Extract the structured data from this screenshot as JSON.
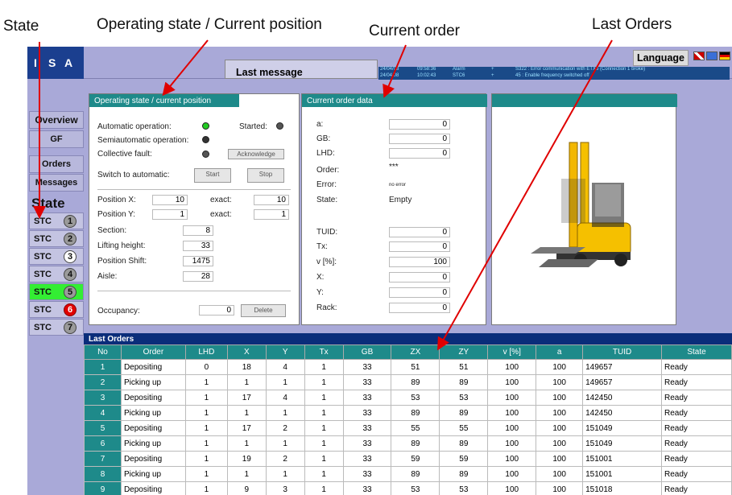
{
  "annotations": {
    "state": "State",
    "operating": "Operating state / Current position",
    "current_order": "Current order",
    "last_orders": "Last Orders"
  },
  "topbar": {
    "last_message_label": "Last message",
    "language_label": "Language",
    "messages": [
      {
        "date": "24/04/08",
        "time": "09:58:36",
        "type": "Alarm",
        "sign": "+",
        "text": "S322 : Error communication with ETX6 (Connection 1 broke)"
      },
      {
        "date": "24/04/08",
        "time": "10:02:43",
        "type": "STC6",
        "sign": "+",
        "text": "45 : Enable frequency switched off"
      }
    ]
  },
  "logo": {
    "letters": [
      "I",
      "S",
      "A"
    ]
  },
  "nav": {
    "overview": "Overview",
    "gf": "GF",
    "orders": "Orders",
    "messages": "Messages",
    "state_title": "State",
    "stc_label": "STC",
    "stcs": [
      "1",
      "2",
      "3",
      "4",
      "5",
      "6",
      "7"
    ]
  },
  "operating": {
    "title": "Operating state / current position",
    "automatic": "Automatic operation:",
    "started": "Started:",
    "semiautomatic": "Semiautomatic operation:",
    "collective_fault": "Collective fault:",
    "acknowledge": "Acknowledge",
    "switch_auto": "Switch to automatic:",
    "start": "Start",
    "stop": "Stop",
    "position_x": "Position X:",
    "position_x_val": "10",
    "exact_label": "exact:",
    "exact_x": "10",
    "position_y": "Position Y:",
    "position_y_val": "1",
    "exact_y": "1",
    "section": "Section:",
    "section_val": "8",
    "lifting": "Lifting height:",
    "lifting_val": "33",
    "shift": "Position Shift:",
    "shift_val": "1475",
    "aisle": "Aisle:",
    "aisle_val": "28",
    "occupancy": "Occupancy:",
    "occupancy_val": "0",
    "delete": "Delete"
  },
  "current_order": {
    "title": "Current order data",
    "a": "a:",
    "a_val": "0",
    "gb": "GB:",
    "gb_val": "0",
    "lhd": "LHD:",
    "lhd_val": "0",
    "order": "Order:",
    "order_val": "***",
    "error": "Error:",
    "error_val": "no error",
    "state": "State:",
    "state_val": "Empty",
    "tuid": "TUID:",
    "tuid_val": "0",
    "tx": "Tx:",
    "tx_val": "0",
    "v": "v [%]:",
    "v_val": "100",
    "x": "X:",
    "x_val": "0",
    "y": "Y:",
    "y_val": "0",
    "rack": "Rack:",
    "rack_val": "0"
  },
  "last_orders": {
    "title": "Last Orders",
    "columns": [
      "No",
      "Order",
      "LHD",
      "X",
      "Y",
      "Tx",
      "GB",
      "ZX",
      "ZY",
      "v [%]",
      "a",
      "TUID",
      "State"
    ],
    "rows": [
      [
        "1",
        "Depositing",
        "0",
        "18",
        "4",
        "1",
        "33",
        "51",
        "51",
        "100",
        "100",
        "149657",
        "Ready"
      ],
      [
        "2",
        "Picking up",
        "1",
        "1",
        "1",
        "1",
        "33",
        "89",
        "89",
        "100",
        "100",
        "149657",
        "Ready"
      ],
      [
        "3",
        "Depositing",
        "1",
        "17",
        "4",
        "1",
        "33",
        "53",
        "53",
        "100",
        "100",
        "142450",
        "Ready"
      ],
      [
        "4",
        "Picking up",
        "1",
        "1",
        "1",
        "1",
        "33",
        "89",
        "89",
        "100",
        "100",
        "142450",
        "Ready"
      ],
      [
        "5",
        "Depositing",
        "1",
        "17",
        "2",
        "1",
        "33",
        "55",
        "55",
        "100",
        "100",
        "151049",
        "Ready"
      ],
      [
        "6",
        "Picking up",
        "1",
        "1",
        "1",
        "1",
        "33",
        "89",
        "89",
        "100",
        "100",
        "151049",
        "Ready"
      ],
      [
        "7",
        "Depositing",
        "1",
        "19",
        "2",
        "1",
        "33",
        "59",
        "59",
        "100",
        "100",
        "151001",
        "Ready"
      ],
      [
        "8",
        "Picking up",
        "1",
        "1",
        "1",
        "1",
        "33",
        "89",
        "89",
        "100",
        "100",
        "151001",
        "Ready"
      ],
      [
        "9",
        "Depositing",
        "1",
        "9",
        "3",
        "1",
        "33",
        "53",
        "53",
        "100",
        "100",
        "151018",
        "Ready"
      ]
    ]
  },
  "colors": {
    "panel_title": "#1e8a8a",
    "app_bg": "#a9a9d8",
    "led_green": "#22cc22",
    "stc5_active": "#33ee33",
    "stc6_alarm": "#e00000"
  }
}
